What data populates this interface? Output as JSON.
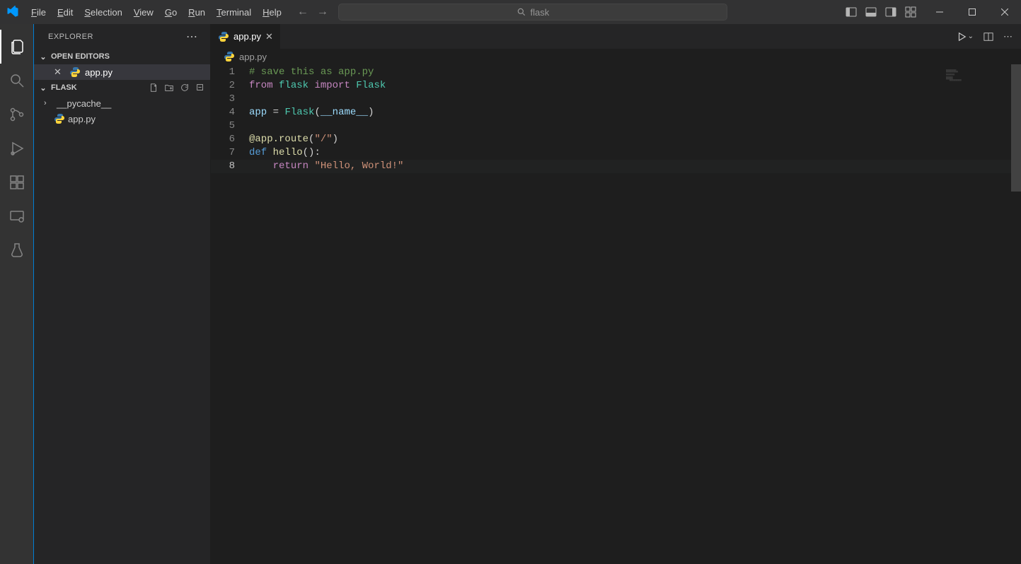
{
  "menu": {
    "file": "File",
    "edit": "Edit",
    "selection": "Selection",
    "view": "View",
    "go": "Go",
    "run": "Run",
    "terminal": "Terminal",
    "help": "Help"
  },
  "search": {
    "placeholder": "flask"
  },
  "explorer": {
    "title": "EXPLORER",
    "openEditors": "OPEN EDITORS",
    "project": "FLASK",
    "openFile": "app.py",
    "tree": {
      "pycache": "__pycache__",
      "app": "app.py"
    }
  },
  "tab": {
    "name": "app.py"
  },
  "breadcrumb": {
    "file": "app.py"
  },
  "code": {
    "l1_comment": "# save this as app.py",
    "l2_from": "from",
    "l2_flask": "flask",
    "l2_import": "import",
    "l2_Flask": "Flask",
    "l4_app": "app",
    "l4_eq": " = ",
    "l4_Flask": "Flask",
    "l4_open": "(",
    "l4_name": "__name__",
    "l4_close": ")",
    "l6_deco": "@app",
    "l6_route": ".route",
    "l6_open": "(",
    "l6_str": "\"/\"",
    "l6_close": ")",
    "l7_def": "def",
    "l7_name": " hello",
    "l7_sig": "():",
    "l8_indent": "    ",
    "l8_return": "return",
    "l8_sp": " ",
    "l8_str": "\"Hello, World!\""
  },
  "lineNumbers": {
    "1": "1",
    "2": "2",
    "3": "3",
    "4": "4",
    "5": "5",
    "6": "6",
    "7": "7",
    "8": "8"
  }
}
